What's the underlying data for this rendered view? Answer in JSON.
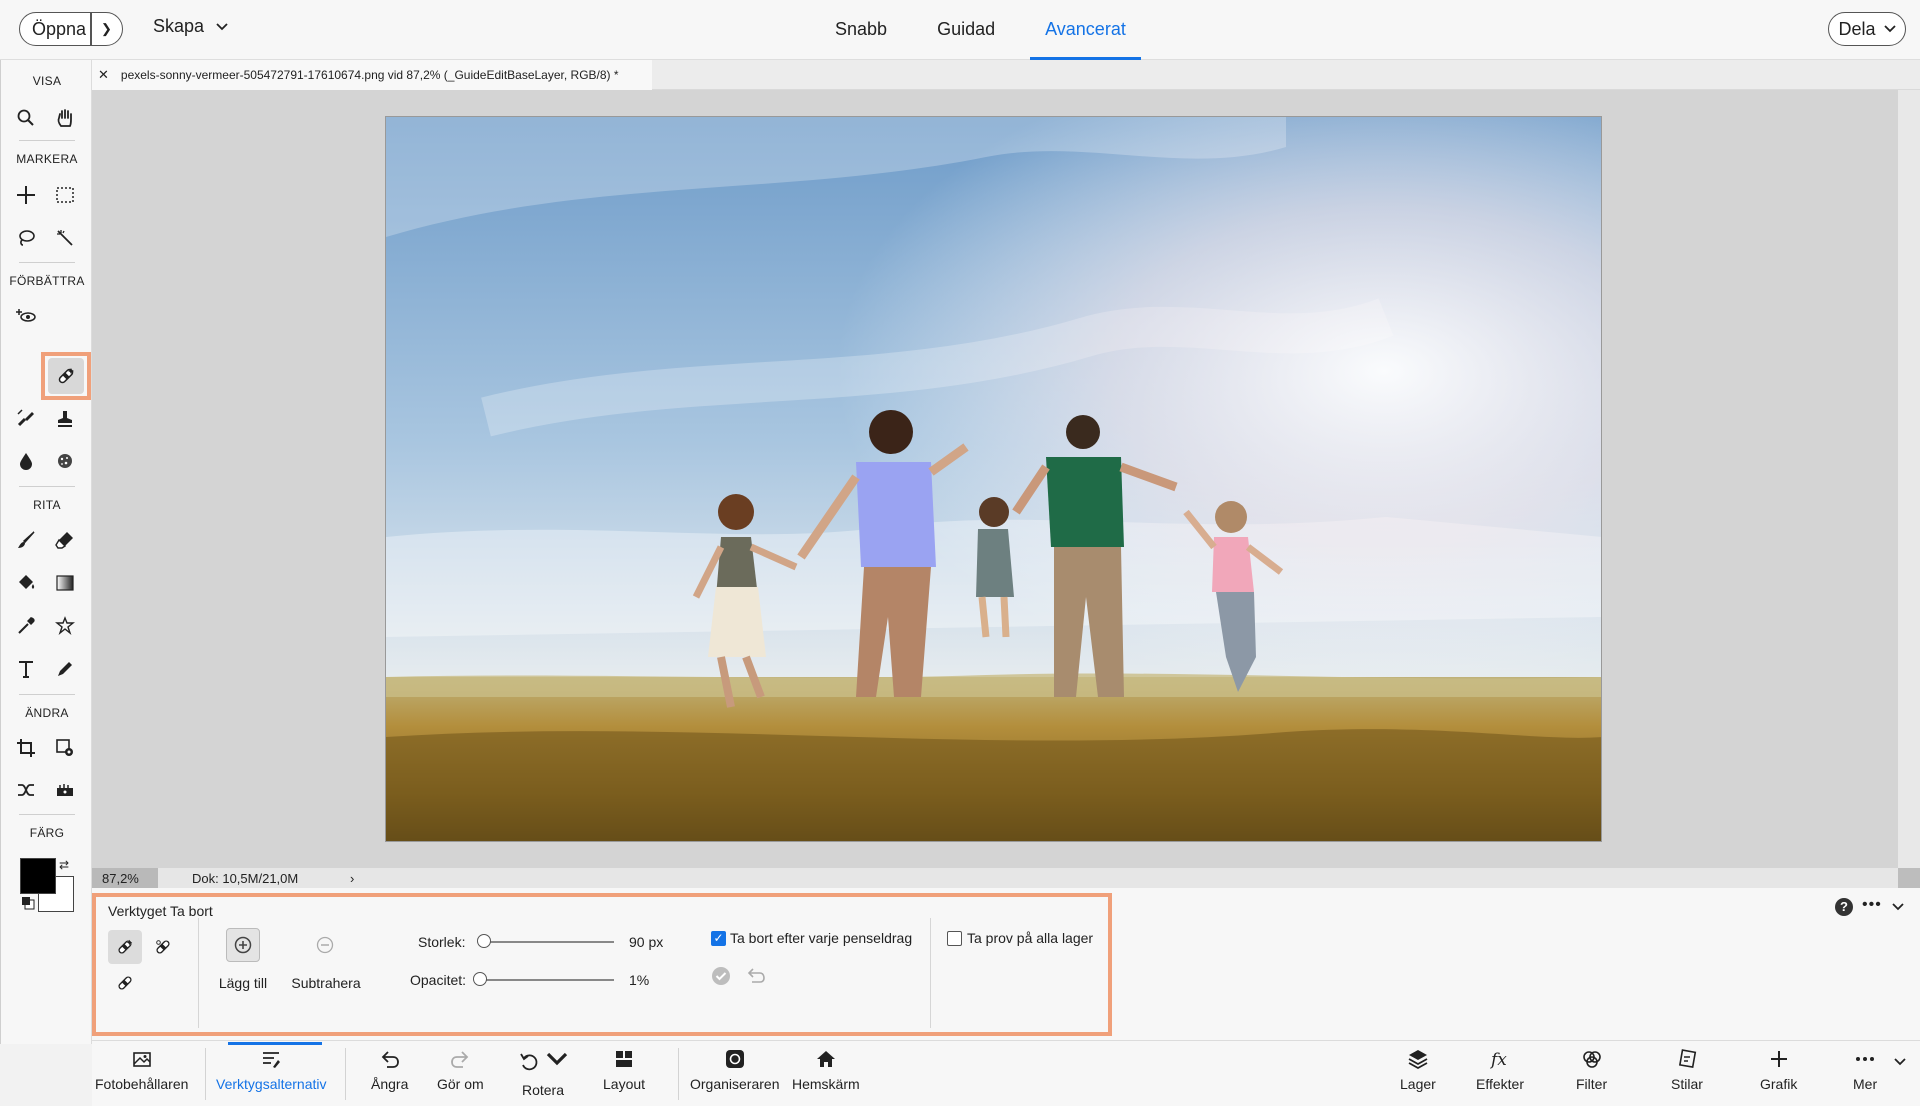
{
  "topbar": {
    "open_label": "Öppna",
    "create_label": "Skapa",
    "share_label": "Dela",
    "modes": [
      "Snabb",
      "Guidad",
      "Avancerat"
    ],
    "active_mode": "Avancerat"
  },
  "toolbar": {
    "sections": {
      "view": "VISA",
      "select": "MARKERA",
      "enhance": "FÖRBÄTTRA",
      "draw": "RITA",
      "modify": "ÄNDRA",
      "color": "FÄRG"
    },
    "selected_tool": "remove-tool",
    "foreground_color": "#000000",
    "background_color": "#ffffff"
  },
  "document": {
    "tab_title": "pexels-sonny-vermeer-505472791-17610674.png vid 87,2% (_GuideEditBaseLayer, RGB/8) *",
    "zoom": "87,2%",
    "doc_size": "Dok: 10,5M/21,0M"
  },
  "tool_options": {
    "title": "Verktyget Ta bort",
    "add_label": "Lägg till",
    "subtract_label": "Subtrahera",
    "size_label": "Storlek:",
    "size_value": "90 px",
    "size_fraction": 0.0,
    "opacity_label": "Opacitet:",
    "opacity_value": "1%",
    "opacity_fraction": 0.01,
    "remove_after_stroke_label": "Ta bort efter varje penseldrag",
    "remove_after_stroke_checked": true,
    "sample_all_layers_label": "Ta prov på alla lager",
    "sample_all_layers_checked": false
  },
  "bottombar": {
    "items": [
      {
        "label": "Fotobehållaren",
        "icon": "photo-bin-icon"
      },
      {
        "label": "Verktygsalternativ",
        "icon": "tool-options-icon"
      },
      {
        "label": "Ångra",
        "icon": "undo-icon"
      },
      {
        "label": "Gör om",
        "icon": "redo-icon"
      },
      {
        "label": "Rotera",
        "icon": "rotate-icon"
      },
      {
        "label": "Layout",
        "icon": "layout-icon"
      },
      {
        "label": "Organiseraren",
        "icon": "organizer-icon"
      },
      {
        "label": "Hemskärm",
        "icon": "home-icon"
      },
      {
        "label": "Lager",
        "icon": "layers-icon"
      },
      {
        "label": "Effekter",
        "icon": "effects-icon"
      },
      {
        "label": "Filter",
        "icon": "filter-icon"
      },
      {
        "label": "Stilar",
        "icon": "styles-icon"
      },
      {
        "label": "Grafik",
        "icon": "graphics-icon"
      },
      {
        "label": "Mer",
        "icon": "more-icon"
      }
    ],
    "active_item": "Verktygsalternativ"
  },
  "colors": {
    "accent": "#1473e6",
    "highlight": "#f0a07a"
  }
}
